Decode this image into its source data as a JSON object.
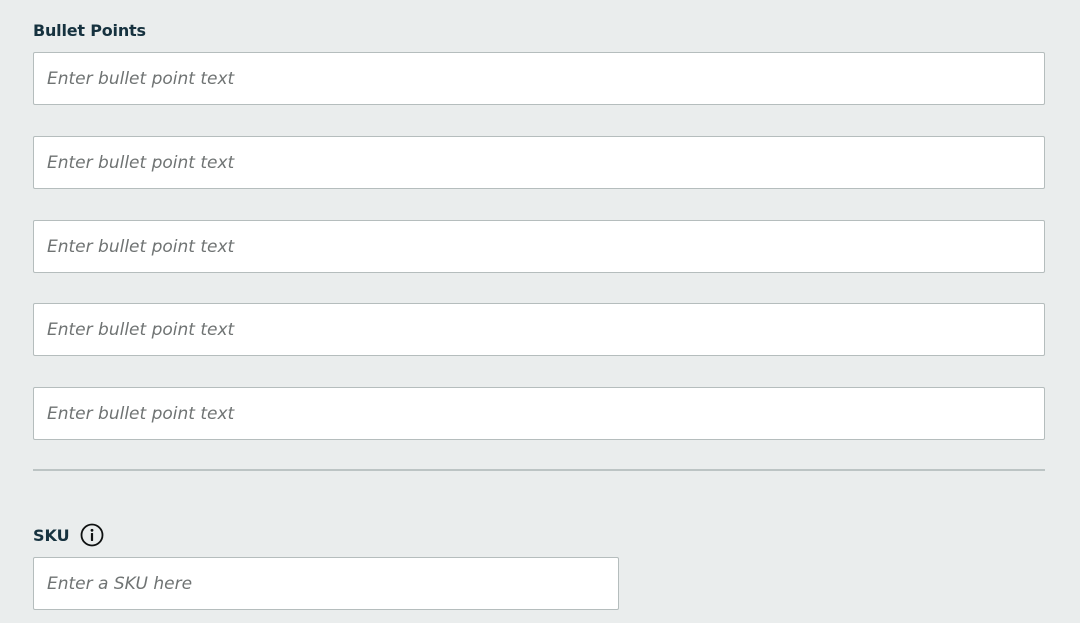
{
  "bullet_points": {
    "label": "Bullet Points",
    "inputs": [
      {
        "value": "",
        "placeholder": "Enter bullet point text"
      },
      {
        "value": "",
        "placeholder": "Enter bullet point text"
      },
      {
        "value": "",
        "placeholder": "Enter bullet point text"
      },
      {
        "value": "",
        "placeholder": "Enter bullet point text"
      },
      {
        "value": "",
        "placeholder": "Enter bullet point text"
      }
    ]
  },
  "sku": {
    "label": "SKU",
    "icon": "info-icon",
    "input": {
      "value": "",
      "placeholder": "Enter a SKU here"
    }
  },
  "colors": {
    "background": "#eaeded",
    "label_text": "#16323f",
    "input_border": "#b5bdbd",
    "placeholder_text": "#6f7373"
  }
}
